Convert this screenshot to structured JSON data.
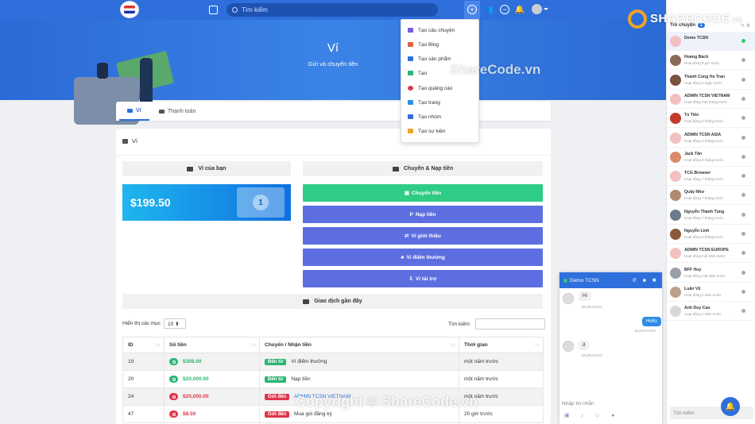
{
  "topbar": {
    "search_placeholder": "Tìm kiếm",
    "icons": [
      "home-icon",
      "plus-circle-icon",
      "users-icon",
      "messenger-icon",
      "bell-icon",
      "user-avatar"
    ]
  },
  "hero": {
    "title": "Ví",
    "subtitle": "Gửi và chuyển tiền"
  },
  "tabs": [
    {
      "label": "Ví"
    },
    {
      "label": "Thanh toán"
    }
  ],
  "card": {
    "title": "Ví"
  },
  "wallet": {
    "your_wallet": "Ví của bạn",
    "transfer_deposit": "Chuyển & Nạp tiền",
    "balance": "$199.50",
    "bill_symbol": "1",
    "actions": [
      {
        "label": "Chuyển tiền",
        "icon": "▣"
      },
      {
        "label": "Nạp tiền",
        "icon": "P"
      },
      {
        "label": "Ví giới thiệu",
        "icon": "⇄"
      },
      {
        "label": "Ví điểm thưởng",
        "icon": "♣"
      },
      {
        "label": "Ví tài trợ",
        "icon": "⇩"
      }
    ],
    "recent": "Giao dịch gần đây"
  },
  "table": {
    "length_label": "Hiển thị các mục",
    "length_value": "10 ⬍",
    "search_label": "Tìm kiếm:",
    "headers": [
      "ID",
      "Số tiền",
      "Chuyển / Nhận tiền",
      "Thời gian"
    ],
    "sort_icons": [
      "↑↓",
      "↑↓",
      "↑↓",
      "↑↓"
    ],
    "rows": [
      {
        "id": "19",
        "amount": "$308.00",
        "type": "g",
        "badge": "Đến từ",
        "desc": "Ví điểm thưởng",
        "time": "một năm trước"
      },
      {
        "id": "20",
        "amount": "$20,000.00",
        "type": "g",
        "badge": "Đến từ",
        "desc": "Nạp tiền",
        "time": "một năm trước"
      },
      {
        "id": "24",
        "amount": "$20,000.00",
        "type": "r",
        "badge": "Gửi đến",
        "desc": "ADMIN TCSN VIETNAM",
        "time": "một năm trước"
      },
      {
        "id": "47",
        "amount": "$8.50",
        "type": "r",
        "badge": "Gửi đến",
        "desc": "Mua gói đăng ký",
        "time": "20 giờ trước"
      }
    ]
  },
  "dropdown": [
    {
      "label": "Tạo câu chuyện",
      "color": "#7b5be0"
    },
    {
      "label": "Tạo Blog",
      "color": "#e0603a"
    },
    {
      "label": "Tạo sản phẩm",
      "color": "#2e6fdb"
    },
    {
      "label": "Tạo",
      "color": "#2bb673"
    },
    {
      "label": "Tạo quảng cáo",
      "color": "#e0364a"
    },
    {
      "label": "Tạo trang",
      "color": "#2e8ce6"
    },
    {
      "label": "Tạo nhóm",
      "color": "#2e6fdb"
    },
    {
      "label": "Tạo sự kiện",
      "color": "#f0a32a"
    }
  ],
  "sidebar": {
    "header": "Trò chuyện",
    "count": "1",
    "header_icons": "✎ ⚙",
    "contacts": [
      {
        "name": "Demo TCSN",
        "status": "",
        "online": true,
        "color": "#f2c0c0"
      },
      {
        "name": "Hoàng Bách",
        "status": "Hoạt động 8 giờ trước",
        "online": false,
        "color": "#8a6b5a"
      },
      {
        "name": "Thanh Cong Ho Tran",
        "status": "Hoạt động 5 ngày trước",
        "online": false,
        "color": "#7a5040"
      },
      {
        "name": "ADMIN TCSN VIETNAM",
        "status": "Hoạt động một tháng trước",
        "online": false,
        "color": "#f2c0c0"
      },
      {
        "name": "Tú Tiến",
        "status": "Hoạt động 2 tháng trước",
        "online": false,
        "color": "#c23a2a"
      },
      {
        "name": "ADMIN TCSN ASIA",
        "status": "Hoạt động 3 tháng trước",
        "online": false,
        "color": "#f2c0c0"
      },
      {
        "name": "Jack Tân",
        "status": "Hoạt động 6 tháng trước",
        "online": false,
        "color": "#d88a6a"
      },
      {
        "name": "TCG Browser",
        "status": "Hoạt động 7 tháng trước",
        "online": false,
        "color": "#f2c0c0"
      },
      {
        "name": "Quây Như",
        "status": "Hoạt động 7 tháng trước",
        "online": false,
        "color": "#b08a70"
      },
      {
        "name": "Nguyễn Thanh Tùng",
        "status": "Hoạt động 7 tháng trước",
        "online": false,
        "color": "#6a7a8a"
      },
      {
        "name": "Nguyễn Linh",
        "status": "Hoạt động 9 tháng trước",
        "online": false,
        "color": "#8a5a3a"
      },
      {
        "name": "ADMIN TCSN EUROPE",
        "status": "Hoạt động một năm trước",
        "online": false,
        "color": "#f2c0c0"
      },
      {
        "name": "BFF Huy",
        "status": "Hoạt động một năm trước",
        "online": false,
        "color": "#9aa0a8"
      },
      {
        "name": "Luân Vũ",
        "status": "Hoạt động 2 năm trước",
        "online": false,
        "color": "#bba08a"
      },
      {
        "name": "Anh Duy Cao",
        "status": "Hoạt động 2 năm trước",
        "online": false,
        "color": "#d8d8d8"
      }
    ],
    "search_placeholder": "Tìm kiếm"
  },
  "chat": {
    "name": "Demo TCSN",
    "icons": "✆ ■ ✖",
    "messages": [
      {
        "text": "Hi",
        "time": "19 phút trước",
        "side": "left"
      },
      {
        "text": "Hello",
        "time": "19 phút trước",
        "side": "right"
      },
      {
        "text": "d",
        "time": "19 phút trước",
        "side": "left"
      }
    ],
    "input_placeholder": "Nhập tin nhắn",
    "tools": "▣ ♪ ☺ ●"
  },
  "brand": {
    "name": "SHARECODE",
    "tld": ".vn"
  },
  "watermarks": [
    "ShareCode.vn",
    "Copyright © ShareCode.vn"
  ]
}
